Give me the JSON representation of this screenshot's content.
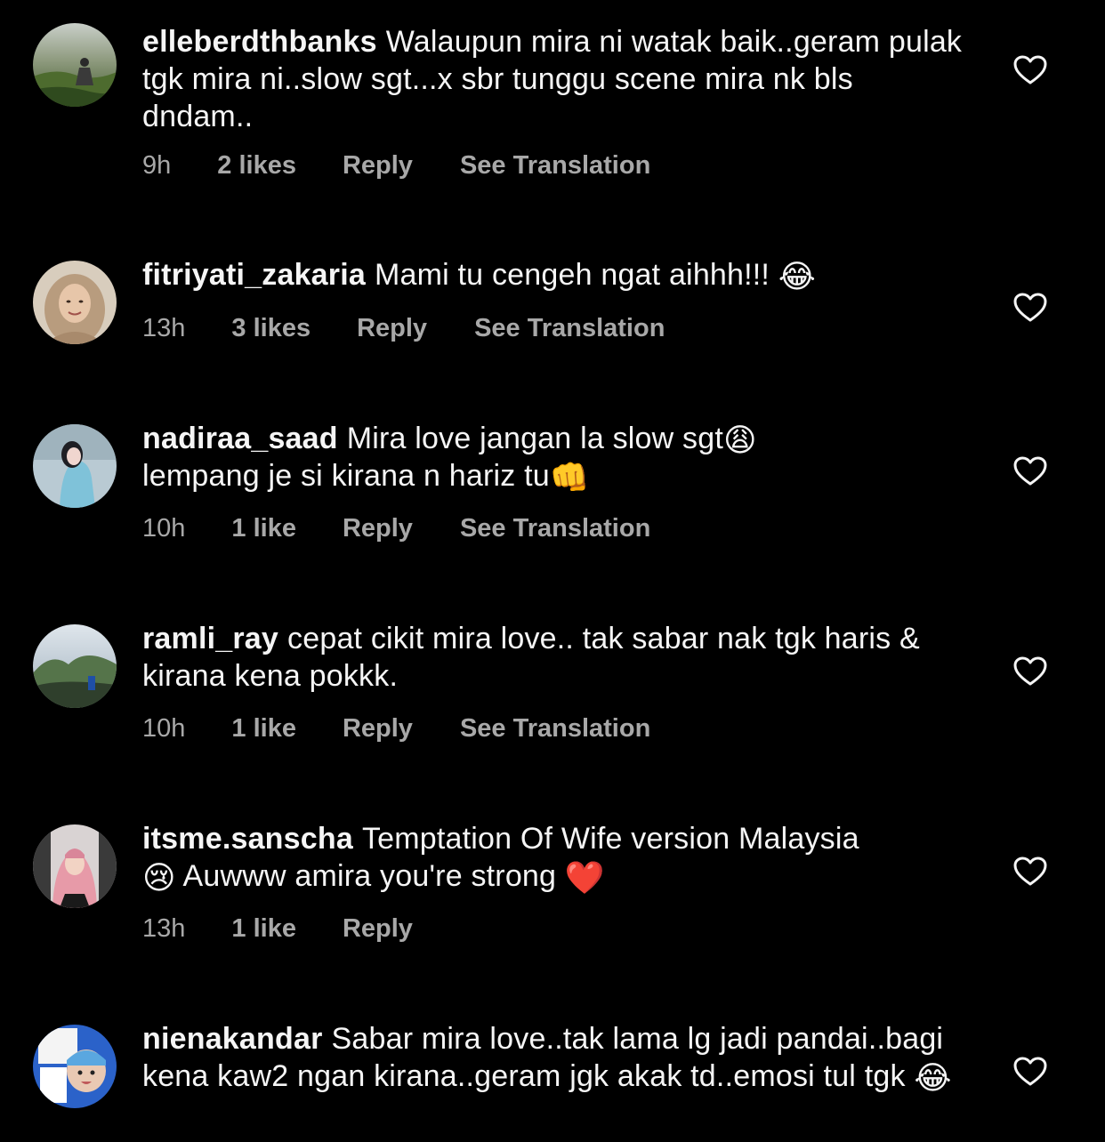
{
  "colors": {
    "background": "#000000",
    "text_primary": "#f5f5f5",
    "text_secondary": "#a8a8a8",
    "heart_emoji": "#e0242c"
  },
  "comments": [
    {
      "username": "elleberdthbanks",
      "text": "Walaupun mira ni watak baik..geram pulak tgk mira ni..slow sgt...x sbr tunggu scene mira nk bls dndam..",
      "time": "9h",
      "likes": "2 likes",
      "reply": "Reply",
      "translate": "See Translation",
      "like_icon": "heart-outline-icon"
    },
    {
      "username": "fitriyati_zakaria",
      "text": "Mami tu cengeh ngat aihhh!!! ",
      "emoji": "😂",
      "time": "13h",
      "likes": "3 likes",
      "reply": "Reply",
      "translate": "See Translation",
      "like_icon": "heart-outline-icon"
    },
    {
      "username": "nadiraa_saad",
      "text_a": "Mira love jangan la slow sgt",
      "emoji_a": "😩",
      "text_b": "lempang je si kirana n hariz tu",
      "emoji_b": "👊",
      "time": "10h",
      "likes": "1 like",
      "reply": "Reply",
      "translate": "See Translation",
      "like_icon": "heart-outline-icon"
    },
    {
      "username": "ramli_ray",
      "text": "cepat cikit mira love.. tak sabar nak tgk haris & kirana kena pokkk.",
      "time": "10h",
      "likes": "1 like",
      "reply": "Reply",
      "translate": "See Translation",
      "like_icon": "heart-outline-icon"
    },
    {
      "username": "itsme.sanscha",
      "text_a": "Temptation Of Wife version Malaysia",
      "emoji_a": "😢",
      "text_b": " Auwww amira you're strong ",
      "emoji_b": "❤️",
      "time": "13h",
      "likes": "1 like",
      "reply": "Reply",
      "like_icon": "heart-outline-icon"
    },
    {
      "username": "nienakandar",
      "text": "Sabar mira love..tak lama lg jadi pandai..bagi kena kaw2 ngan kirana..geram jgk akak td..emosi tul tgk ",
      "emoji": "😂",
      "like_icon": "heart-outline-icon"
    }
  ]
}
